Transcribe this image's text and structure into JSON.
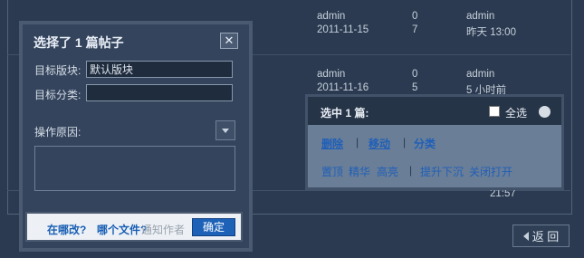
{
  "background_list": {
    "rows": [
      {
        "author": "admin",
        "date": "2011-11-15",
        "replies": "0",
        "views": "7",
        "last_user": "admin",
        "last_time": "昨天 13:00"
      },
      {
        "author": "admin",
        "date": "2011-11-16",
        "replies": "0",
        "views": "5",
        "last_user": "admin",
        "last_time": "5 小时前"
      },
      {
        "last_time": "21:57"
      }
    ],
    "back_label": "返 回"
  },
  "modal": {
    "title": "选择了 1 篇帖子",
    "close_glyph": "✕",
    "target_board_label": "目标版块:",
    "target_board_value": "默认版块",
    "target_category_label": "目标分类:",
    "target_category_value": "",
    "reason_label": "操作原因:",
    "footer_link1": "在哪改?",
    "footer_link2": "哪个文件?",
    "footer_gray": "通知作者",
    "confirm_label": "确定"
  },
  "panel": {
    "title": "选中 1 篇:",
    "select_all_label": "全选",
    "ops_row1": [
      "删除",
      "移动",
      "分类"
    ],
    "ops_row2": [
      "置顶",
      "精华",
      "高亮",
      "提升下沉",
      "关闭打开"
    ],
    "separator": "|"
  }
}
